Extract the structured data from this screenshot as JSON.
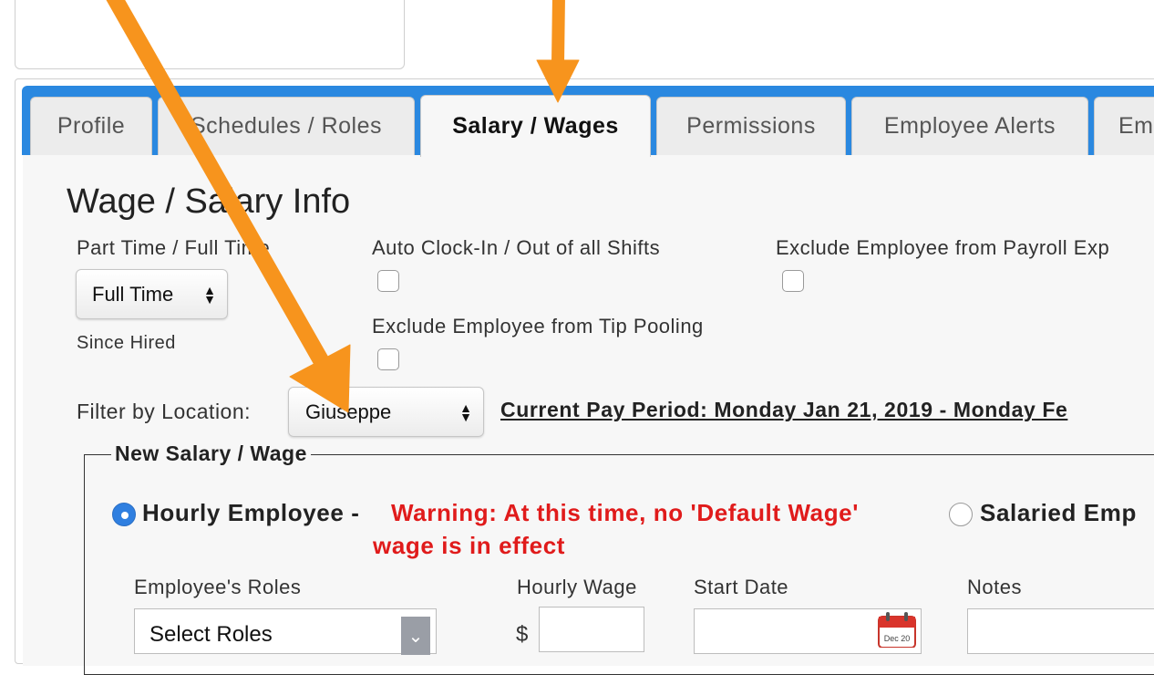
{
  "tabs": [
    {
      "label": "Profile"
    },
    {
      "label": "Schedules / Roles"
    },
    {
      "label": "Salary / Wages"
    },
    {
      "label": "Permissions"
    },
    {
      "label": "Employee Alerts"
    },
    {
      "label": "Em"
    }
  ],
  "section_title": "Wage / Salary Info",
  "part_time_full_time": {
    "label": "Part Time / Full Time",
    "value": "Full Time",
    "note": "Since Hired"
  },
  "auto_clock": {
    "label": "Auto Clock-In / Out of all Shifts"
  },
  "exclude_payroll": {
    "label": "Exclude Employee from Payroll Exp"
  },
  "exclude_tip": {
    "label": "Exclude Employee from Tip Pooling"
  },
  "filter": {
    "label": "Filter by Location:",
    "value": "Giuseppe"
  },
  "pay_period": "Current Pay Period: Monday Jan 21, 2019 - Monday Fe",
  "new_wage": {
    "legend": "New Salary / Wage",
    "hourly_label": "Hourly Employee -",
    "warning_line1": "Warning: At this time, no 'Default Wage'",
    "warning_line2": "wage is in effect",
    "salaried_label": "Salaried Emp",
    "roles_label": "Employee's Roles",
    "roles_select": "Select Roles",
    "hourly_wage_label": "Hourly Wage",
    "currency": "$",
    "start_date_label": "Start Date",
    "notes_label": "Notes",
    "calendar_text": "Dec 20"
  },
  "colors": {
    "tab_bar": "#2a88e0",
    "warning": "#e01b1b",
    "annotation_arrow": "#f7941d",
    "radio_selected": "#2f7fe0"
  }
}
